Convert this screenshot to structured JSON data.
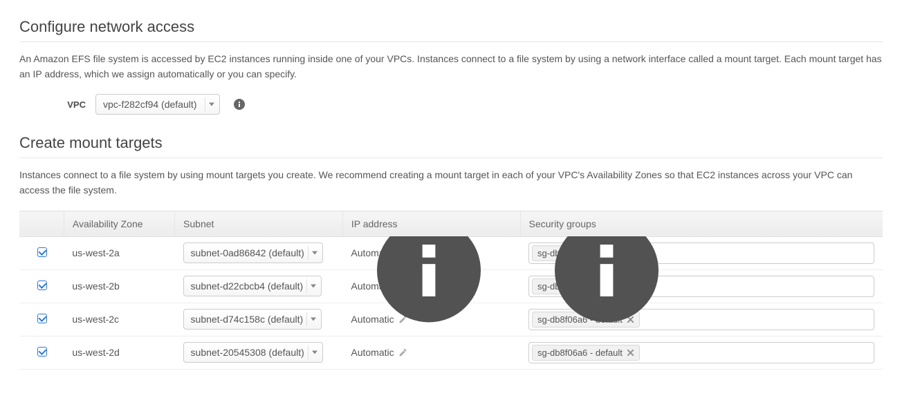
{
  "sections": {
    "network": {
      "title": "Configure network access",
      "description": "An Amazon EFS file system is accessed by EC2 instances running inside one of your VPCs. Instances connect to a file system by using a network interface called a mount target. Each mount target has an IP address, which we assign automatically or you can specify."
    },
    "mount": {
      "title": "Create mount targets",
      "description": "Instances connect to a file system by using mount targets you create. We recommend creating a mount target in each of your VPC's Availability Zones so that EC2 instances across your VPC can access the file system."
    }
  },
  "vpc": {
    "label": "VPC",
    "selected": "vpc-f282cf94 (default)"
  },
  "table": {
    "headers": {
      "az": "Availability Zone",
      "subnet": "Subnet",
      "ip": "IP address",
      "sg": "Security groups"
    },
    "rows": [
      {
        "checked": true,
        "az": "us-west-2a",
        "subnet": "subnet-0ad86842 (default)",
        "ip": "Automatic",
        "sg": "sg-db8f06a6 - default"
      },
      {
        "checked": true,
        "az": "us-west-2b",
        "subnet": "subnet-d22cbcb4 (default)",
        "ip": "Automatic",
        "sg": "sg-db8f06a6 - default"
      },
      {
        "checked": true,
        "az": "us-west-2c",
        "subnet": "subnet-d74c158c (default)",
        "ip": "Automatic",
        "sg": "sg-db8f06a6 - default"
      },
      {
        "checked": true,
        "az": "us-west-2d",
        "subnet": "subnet-20545308 (default)",
        "ip": "Automatic",
        "sg": "sg-db8f06a6 - default"
      }
    ]
  }
}
